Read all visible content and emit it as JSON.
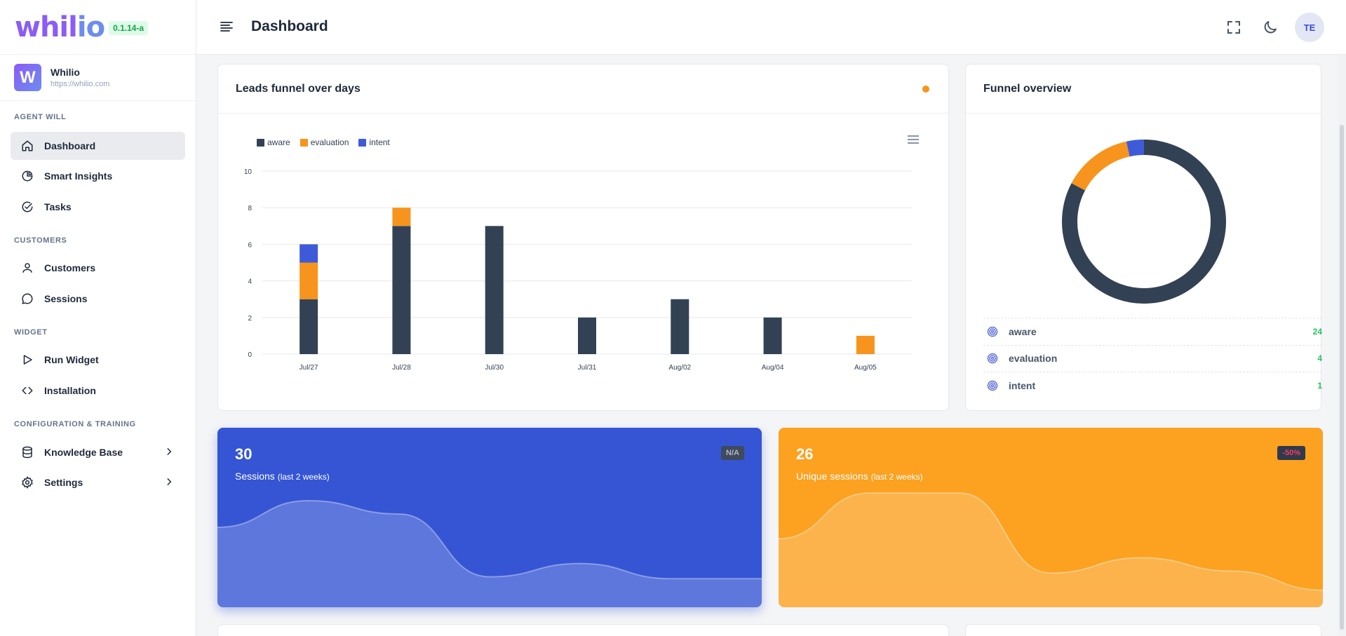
{
  "brand": {
    "logo_part1": "whil",
    "logo_part2": "io",
    "version": "0.1.14-a"
  },
  "workspace": {
    "avatar_letter": "W",
    "name": "Whilio",
    "url": "https://whilio.com"
  },
  "sidebar": {
    "sections": [
      {
        "label": "AGENT WILL"
      },
      {
        "label": "CUSTOMERS"
      },
      {
        "label": "WIDGET"
      },
      {
        "label": "CONFIGURATION & TRAINING"
      }
    ],
    "items": [
      {
        "label": "Dashboard",
        "icon": "home-icon",
        "active": true
      },
      {
        "label": "Smart Insights",
        "icon": "pie-chart-icon"
      },
      {
        "label": "Tasks",
        "icon": "check-circle-icon"
      },
      {
        "label": "Customers",
        "icon": "user-icon"
      },
      {
        "label": "Sessions",
        "icon": "chat-bubble-icon"
      },
      {
        "label": "Run Widget",
        "icon": "play-icon"
      },
      {
        "label": "Installation",
        "icon": "code-icon"
      },
      {
        "label": "Knowledge Base",
        "icon": "database-icon",
        "has_submenu": true
      },
      {
        "label": "Settings",
        "icon": "gear-icon",
        "has_submenu": true
      }
    ]
  },
  "header": {
    "title": "Dashboard",
    "user_initials": "TE"
  },
  "leads_card": {
    "title": "Leads funnel over days"
  },
  "funnel_card": {
    "title": "Funnel overview",
    "rows": [
      {
        "name": "aware",
        "value": "24"
      },
      {
        "name": "evaluation",
        "value": "4"
      },
      {
        "name": "intent",
        "value": "1"
      }
    ]
  },
  "stats": [
    {
      "value": "30",
      "label": "Sessions",
      "sublabel": "(last 2 weeks)",
      "badge": "N/A",
      "color": "#3555d4"
    },
    {
      "value": "26",
      "label": "Unique sessions",
      "sublabel": "(last 2 weeks)",
      "badge": "-50%",
      "color": "#fca120"
    }
  ],
  "colors": {
    "aware": "#334155",
    "evaluation": "#f7941d",
    "intent": "#3d5bd9",
    "positive": "#22c55e",
    "negative": "#f43f5e"
  },
  "chart_data": [
    {
      "type": "bar",
      "stacked": true,
      "categories": [
        "Jul/27",
        "Jul/28",
        "Jul/30",
        "Jul/31",
        "Aug/02",
        "Aug/04",
        "Aug/05"
      ],
      "series": [
        {
          "name": "aware",
          "values": [
            3,
            7,
            7,
            2,
            3,
            2,
            0
          ]
        },
        {
          "name": "evaluation",
          "values": [
            2,
            1,
            0,
            0,
            0,
            0,
            1
          ]
        },
        {
          "name": "intent",
          "values": [
            1,
            0,
            0,
            0,
            0,
            0,
            0
          ]
        }
      ],
      "yticks": [
        "0",
        "2",
        "4",
        "6",
        "8",
        "10"
      ],
      "ylim": [
        0,
        10
      ],
      "grid": true,
      "legend": "top-left"
    },
    {
      "type": "pie",
      "donut": true,
      "labels": [
        "aware",
        "evaluation",
        "intent"
      ],
      "values": [
        24,
        4,
        1
      ]
    },
    {
      "type": "area",
      "values": [
        4.2,
        5.6,
        4.9,
        1.6,
        2.3,
        1.5,
        1.5
      ]
    },
    {
      "type": "area",
      "values": [
        3.6,
        6.0,
        6.0,
        1.8,
        2.6,
        1.9,
        0.9
      ]
    }
  ]
}
